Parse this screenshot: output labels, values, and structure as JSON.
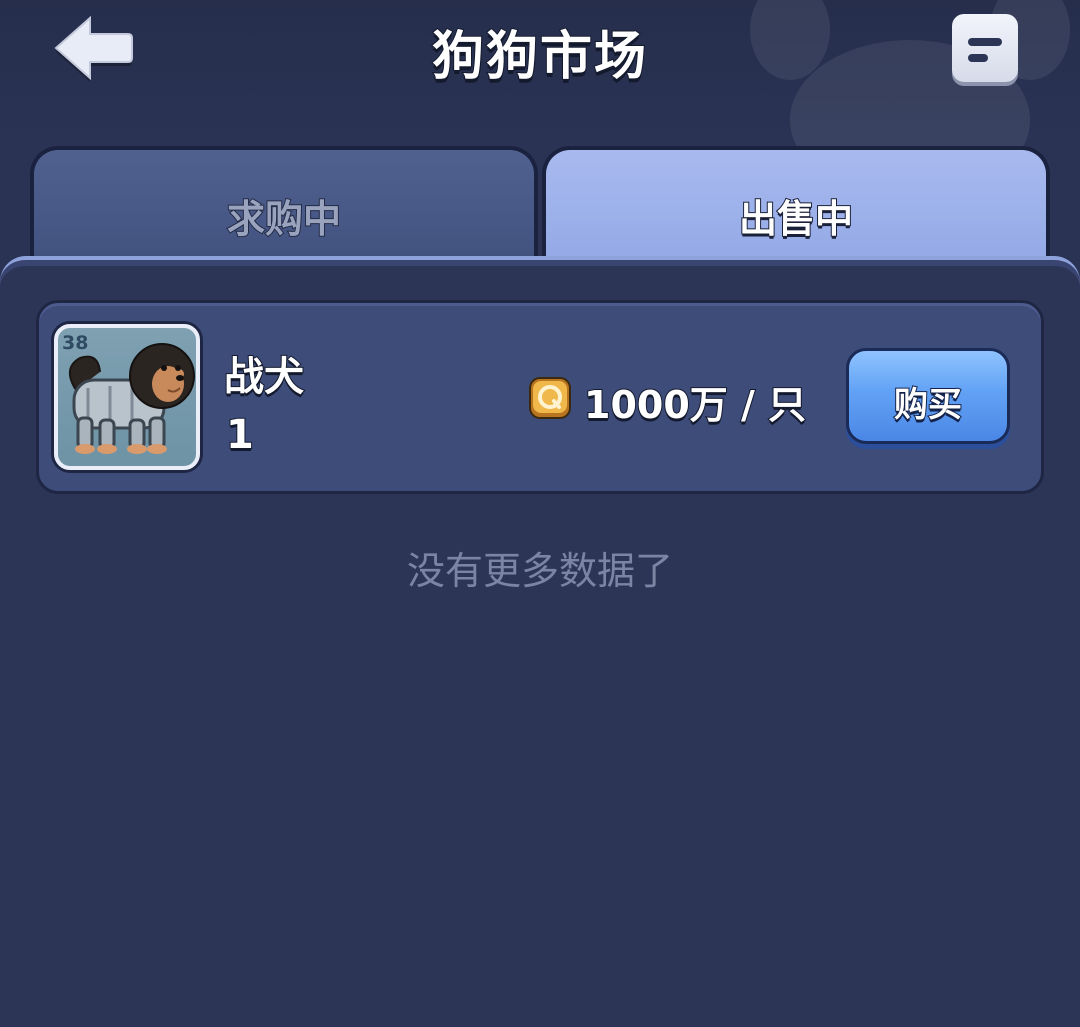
{
  "header": {
    "title": "狗狗市场"
  },
  "tabs": [
    {
      "label": "求购中",
      "active": false
    },
    {
      "label": "出售中",
      "active": true
    }
  ],
  "listings": [
    {
      "level": "38",
      "name": "战犬",
      "count": "1",
      "price": "1000万 / 只",
      "buy_label": "购买"
    }
  ],
  "empty_hint": "没有更多数据了",
  "colors": {
    "background": "#2c3556",
    "card": "#3e4c7a",
    "active_tab": "#9cb0ea",
    "inactive_tab": "#485886",
    "buy_button": "#62a2f5",
    "coin": "#e0a63a"
  },
  "icons": {
    "back": "back-arrow-icon",
    "menu": "menu-icon",
    "coin": "q-coin-icon",
    "dog": "war-dog-avatar"
  }
}
